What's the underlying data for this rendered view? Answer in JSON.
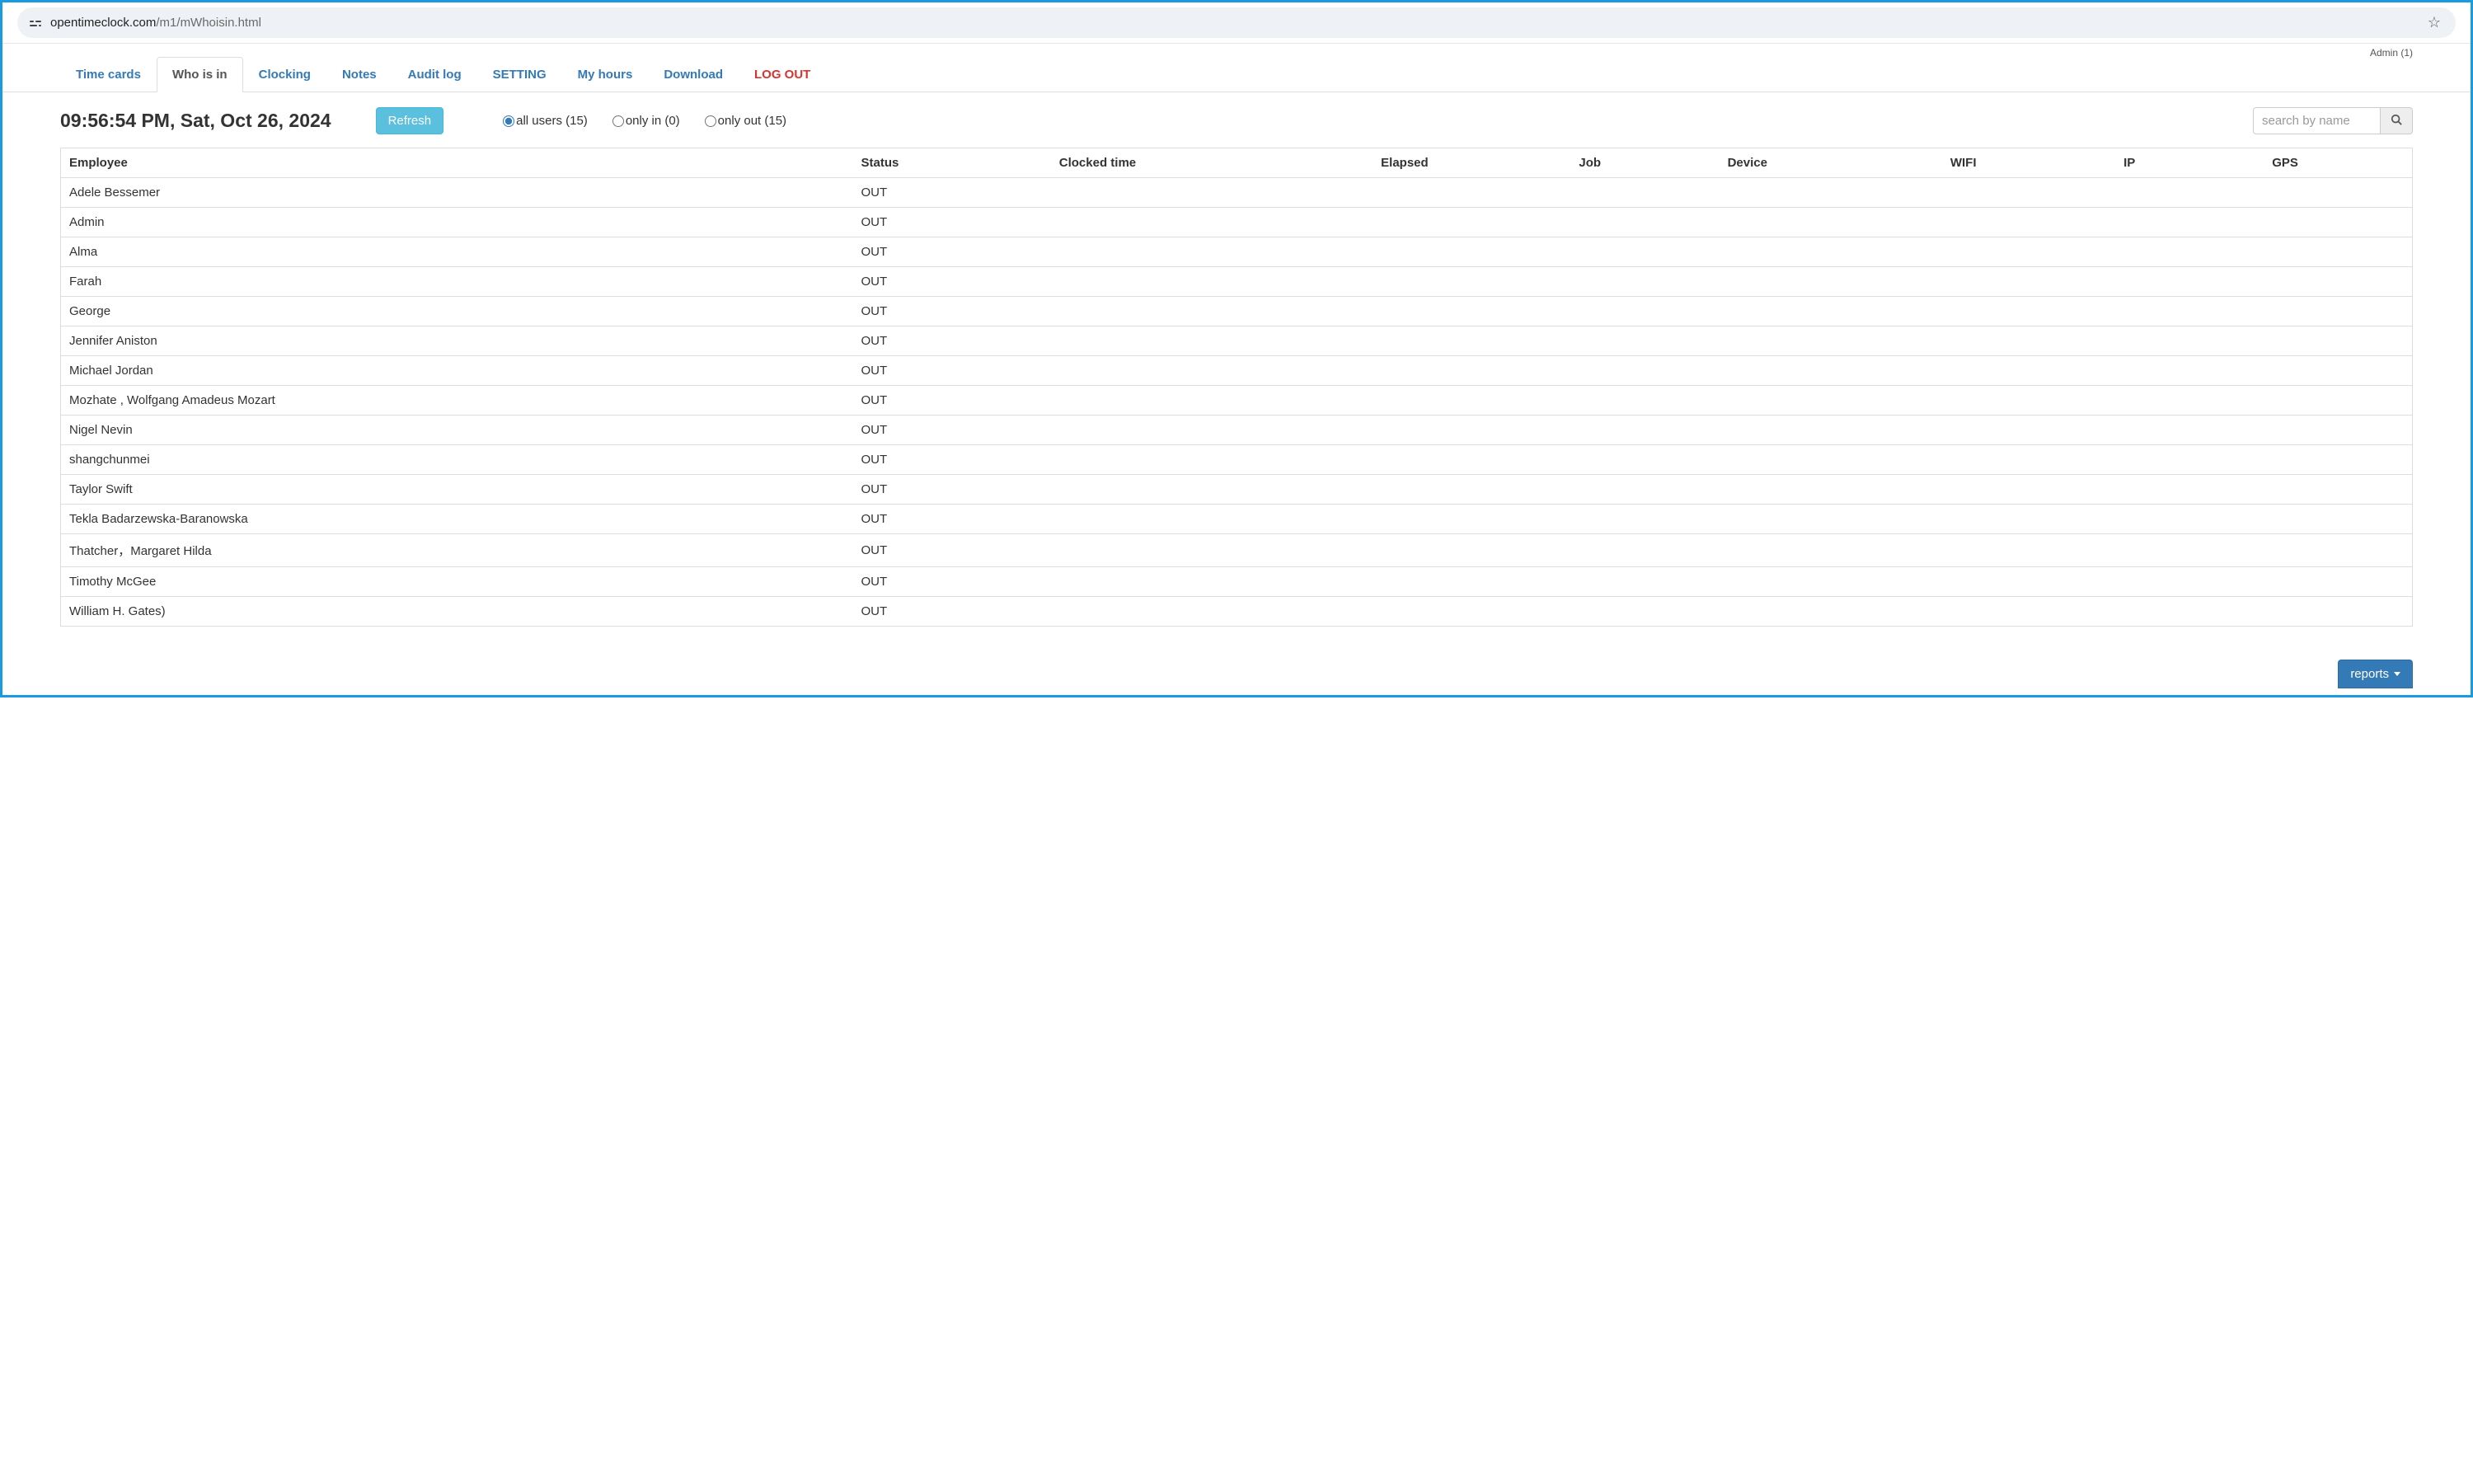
{
  "browser": {
    "url_domain": "opentimeclock.com",
    "url_path": "/m1/mWhoisin.html"
  },
  "header": {
    "user_label": "Admin (1)"
  },
  "nav": {
    "tabs": [
      {
        "label": "Time cards",
        "active": false
      },
      {
        "label": "Who is in",
        "active": true
      },
      {
        "label": "Clocking",
        "active": false
      },
      {
        "label": "Notes",
        "active": false
      },
      {
        "label": "Audit log",
        "active": false
      },
      {
        "label": "SETTING",
        "active": false
      },
      {
        "label": "My hours",
        "active": false
      },
      {
        "label": "Download",
        "active": false
      },
      {
        "label": "LOG OUT",
        "active": false,
        "logout": true
      }
    ]
  },
  "controls": {
    "datetime": "09:56:54 PM, Sat, Oct 26, 2024",
    "refresh_label": "Refresh",
    "filters": [
      {
        "label": "all users (15)",
        "checked": true
      },
      {
        "label": "only in (0)",
        "checked": false
      },
      {
        "label": "only out (15)",
        "checked": false
      }
    ],
    "search_placeholder": "search by name"
  },
  "table": {
    "columns": [
      "Employee",
      "Status",
      "Clocked time",
      "Elapsed",
      "Job",
      "Device",
      "WIFI",
      "IP",
      "GPS"
    ],
    "rows": [
      {
        "employee": "Adele Bessemer",
        "status": "OUT",
        "clocked_time": "",
        "elapsed": "",
        "job": "",
        "device": "",
        "wifi": "",
        "ip": "",
        "gps": ""
      },
      {
        "employee": "Admin",
        "status": "OUT",
        "clocked_time": "",
        "elapsed": "",
        "job": "",
        "device": "",
        "wifi": "",
        "ip": "",
        "gps": ""
      },
      {
        "employee": "Alma",
        "status": "OUT",
        "clocked_time": "",
        "elapsed": "",
        "job": "",
        "device": "",
        "wifi": "",
        "ip": "",
        "gps": ""
      },
      {
        "employee": "Farah",
        "status": "OUT",
        "clocked_time": "",
        "elapsed": "",
        "job": "",
        "device": "",
        "wifi": "",
        "ip": "",
        "gps": ""
      },
      {
        "employee": "George",
        "status": "OUT",
        "clocked_time": "",
        "elapsed": "",
        "job": "",
        "device": "",
        "wifi": "",
        "ip": "",
        "gps": ""
      },
      {
        "employee": "Jennifer Aniston",
        "status": "OUT",
        "clocked_time": "",
        "elapsed": "",
        "job": "",
        "device": "",
        "wifi": "",
        "ip": "",
        "gps": ""
      },
      {
        "employee": "Michael Jordan",
        "status": "OUT",
        "clocked_time": "",
        "elapsed": "",
        "job": "",
        "device": "",
        "wifi": "",
        "ip": "",
        "gps": ""
      },
      {
        "employee": "Mozhate , Wolfgang Amadeus Mozart",
        "status": "OUT",
        "clocked_time": "",
        "elapsed": "",
        "job": "",
        "device": "",
        "wifi": "",
        "ip": "",
        "gps": ""
      },
      {
        "employee": "Nigel Nevin",
        "status": "OUT",
        "clocked_time": "",
        "elapsed": "",
        "job": "",
        "device": "",
        "wifi": "",
        "ip": "",
        "gps": ""
      },
      {
        "employee": "shangchunmei",
        "status": "OUT",
        "clocked_time": "",
        "elapsed": "",
        "job": "",
        "device": "",
        "wifi": "",
        "ip": "",
        "gps": ""
      },
      {
        "employee": "Taylor Swift",
        "status": "OUT",
        "clocked_time": "",
        "elapsed": "",
        "job": "",
        "device": "",
        "wifi": "",
        "ip": "",
        "gps": ""
      },
      {
        "employee": "Tekla Badarzewska-Baranowska",
        "status": "OUT",
        "clocked_time": "",
        "elapsed": "",
        "job": "",
        "device": "",
        "wifi": "",
        "ip": "",
        "gps": ""
      },
      {
        "employee": "Thatcher，Margaret Hilda",
        "status": "OUT",
        "clocked_time": "",
        "elapsed": "",
        "job": "",
        "device": "",
        "wifi": "",
        "ip": "",
        "gps": ""
      },
      {
        "employee": "Timothy McGee",
        "status": "OUT",
        "clocked_time": "",
        "elapsed": "",
        "job": "",
        "device": "",
        "wifi": "",
        "ip": "",
        "gps": ""
      },
      {
        "employee": "William H. Gates)",
        "status": "OUT",
        "clocked_time": "",
        "elapsed": "",
        "job": "",
        "device": "",
        "wifi": "",
        "ip": "",
        "gps": ""
      }
    ]
  },
  "footer": {
    "reports_label": "reports"
  }
}
